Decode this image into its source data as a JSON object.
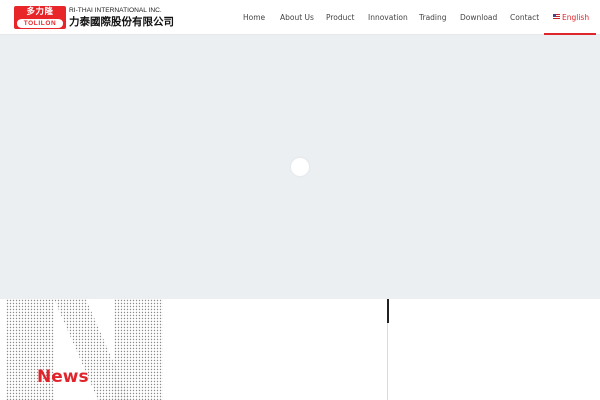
{
  "brand": {
    "badge_top": "多力隆",
    "badge_bottom": "TOLILON",
    "name_en": "RI-THAI INTERNATIONAL INC.",
    "name_zh": "力泰國際股份有限公司"
  },
  "nav": {
    "items": [
      "Home",
      "About Us",
      "Product",
      "Innovation",
      "Trading",
      "Download",
      "Contact"
    ],
    "language": "English",
    "language_icon": "us-flag-icon",
    "active_color": "#e0242b"
  },
  "hero": {
    "background": "#eceff2",
    "loader_icon": "loading-circle-icon"
  },
  "news": {
    "title": "News",
    "title_color": "#e0242b"
  }
}
